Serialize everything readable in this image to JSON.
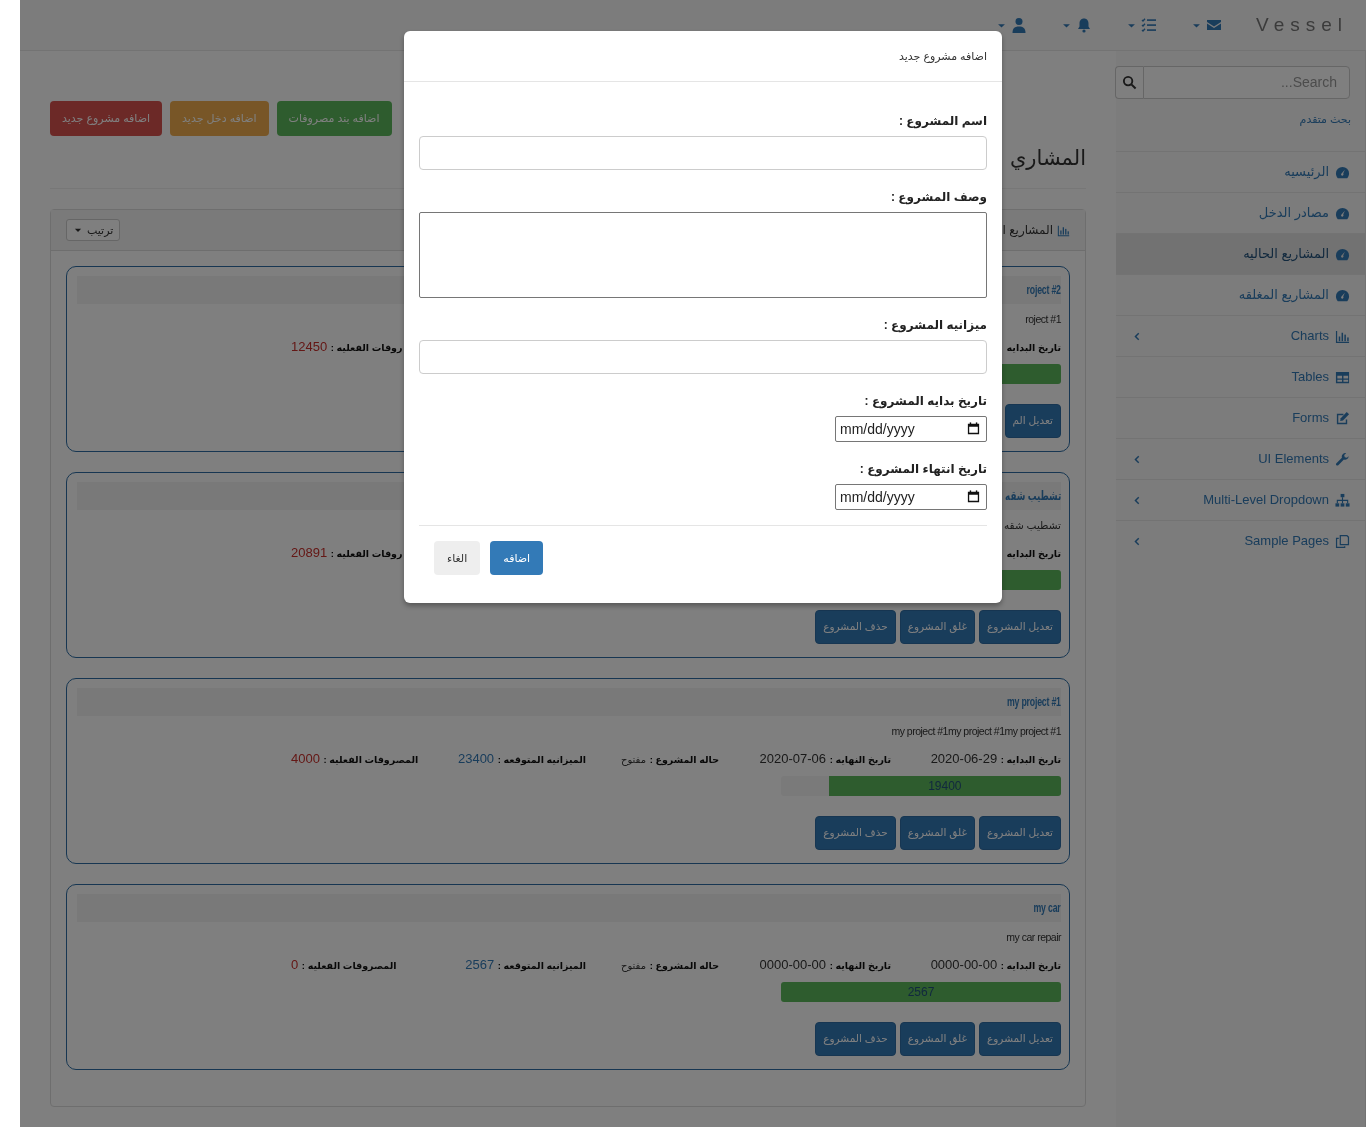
{
  "navbar": {
    "brand": "Vessel"
  },
  "sidebar": {
    "search": {
      "placeholder": "Search..."
    },
    "advanced_search": "بحث متقدم",
    "items": [
      {
        "label": "الرئيسيه",
        "selected": false,
        "collapsible": false
      },
      {
        "label": "مصادر الدخل",
        "selected": false,
        "collapsible": false
      },
      {
        "label": "المشاريع الحاليه",
        "selected": true,
        "collapsible": false
      },
      {
        "label": "المشاريع المغلقه",
        "selected": false,
        "collapsible": false
      },
      {
        "label": "Charts",
        "selected": false,
        "collapsible": true
      },
      {
        "label": "Tables",
        "selected": false,
        "collapsible": false
      },
      {
        "label": "Forms",
        "selected": false,
        "collapsible": false
      },
      {
        "label": "UI Elements",
        "selected": false,
        "collapsible": true
      },
      {
        "label": "Multi-Level Dropdown",
        "selected": false,
        "collapsible": true
      },
      {
        "label": "Sample Pages",
        "selected": false,
        "collapsible": true
      }
    ]
  },
  "page": {
    "title": "المشاري",
    "actions": [
      "اضافه بند مصروفات",
      "اضافه دخل جديد",
      "اضافه مشروع جديد"
    ],
    "panel": {
      "title": "المشاريع ا",
      "sort_button": "ترتيب",
      "projects": [
        {
          "title": "roject #2",
          "description": "roject #1",
          "fields": [
            {
              "kind": "start",
              "label": "تاريخ البدايه"
            },
            {
              "kind": "spent",
              "label": "روفات الفعليه :",
              "value": "12450"
            }
          ],
          "progress": {
            "level": 1
          },
          "buttons": [
            "تعديل الم"
          ]
        },
        {
          "title": "تشطيب شقه",
          "description": "تشطيب شقه",
          "fields": [
            {
              "kind": "start",
              "label": "تاريخ البدايه"
            },
            {
              "kind": "spent",
              "label": "روفات الفعليه :",
              "value": "20891"
            }
          ],
          "progress": {
            "level": 1
          },
          "buttons": [
            "تعديل المشروع",
            "غلق المشروع",
            "حذف المشروع"
          ]
        },
        {
          "title": "my project #1",
          "description": "my project #1my project #1my project #1",
          "fields": [
            {
              "kind": "start",
              "label": "تاريخ البدايه :",
              "value": "2020-06-29"
            },
            {
              "kind": "end",
              "label": "تاريخ النهايه :",
              "value": "2020-07-06"
            },
            {
              "kind": "status",
              "label": "حاله المشروع :",
              "value": "مفتوح"
            },
            {
              "kind": "budget",
              "label": "الميزانيه المتوقعه :",
              "value": "23400"
            },
            {
              "kind": "spent",
              "label": "المصروفات الفعليه :",
              "value": "4000"
            }
          ],
          "progress": {
            "level": 0.83,
            "label": "19400"
          },
          "buttons": [
            "تعديل المشروع",
            "غلق المشروع",
            "حذف المشروع"
          ]
        },
        {
          "title": "my car",
          "description": "my car repair",
          "fields": [
            {
              "kind": "start",
              "label": "تاريخ البدايه :",
              "value": "0000-00-00"
            },
            {
              "kind": "end",
              "label": "تاريخ النهايه :",
              "value": "0000-00-00"
            },
            {
              "kind": "status",
              "label": "حاله المشروع :",
              "value": "مفتوح"
            },
            {
              "kind": "budget",
              "label": "الميزانيه المتوقعه :",
              "value": "2567"
            },
            {
              "kind": "spent",
              "label": "المصروفات الفعليه :",
              "value": "0"
            }
          ],
          "progress": {
            "level": 1,
            "label": "2567"
          },
          "buttons": [
            "تعديل المشروع",
            "غلق المشروع",
            "حذف المشروع"
          ]
        }
      ]
    }
  },
  "modal": {
    "title": "اضافه مشروع جديد",
    "fields": [
      {
        "kind": "text",
        "label": "اسم المشروع :"
      },
      {
        "kind": "textarea",
        "label": "وصف المشروع :"
      },
      {
        "kind": "text",
        "label": "ميزانيه المشروع :"
      },
      {
        "kind": "date",
        "label": "تاريخ بدايه المشروع :",
        "placeholder": "mm/dd/yyyy"
      },
      {
        "kind": "date",
        "label": "تاريخ انتهاء المشروع :",
        "placeholder": "mm/dd/yyyy"
      }
    ],
    "buttons": [
      "اضافه",
      "الغاء"
    ]
  }
}
